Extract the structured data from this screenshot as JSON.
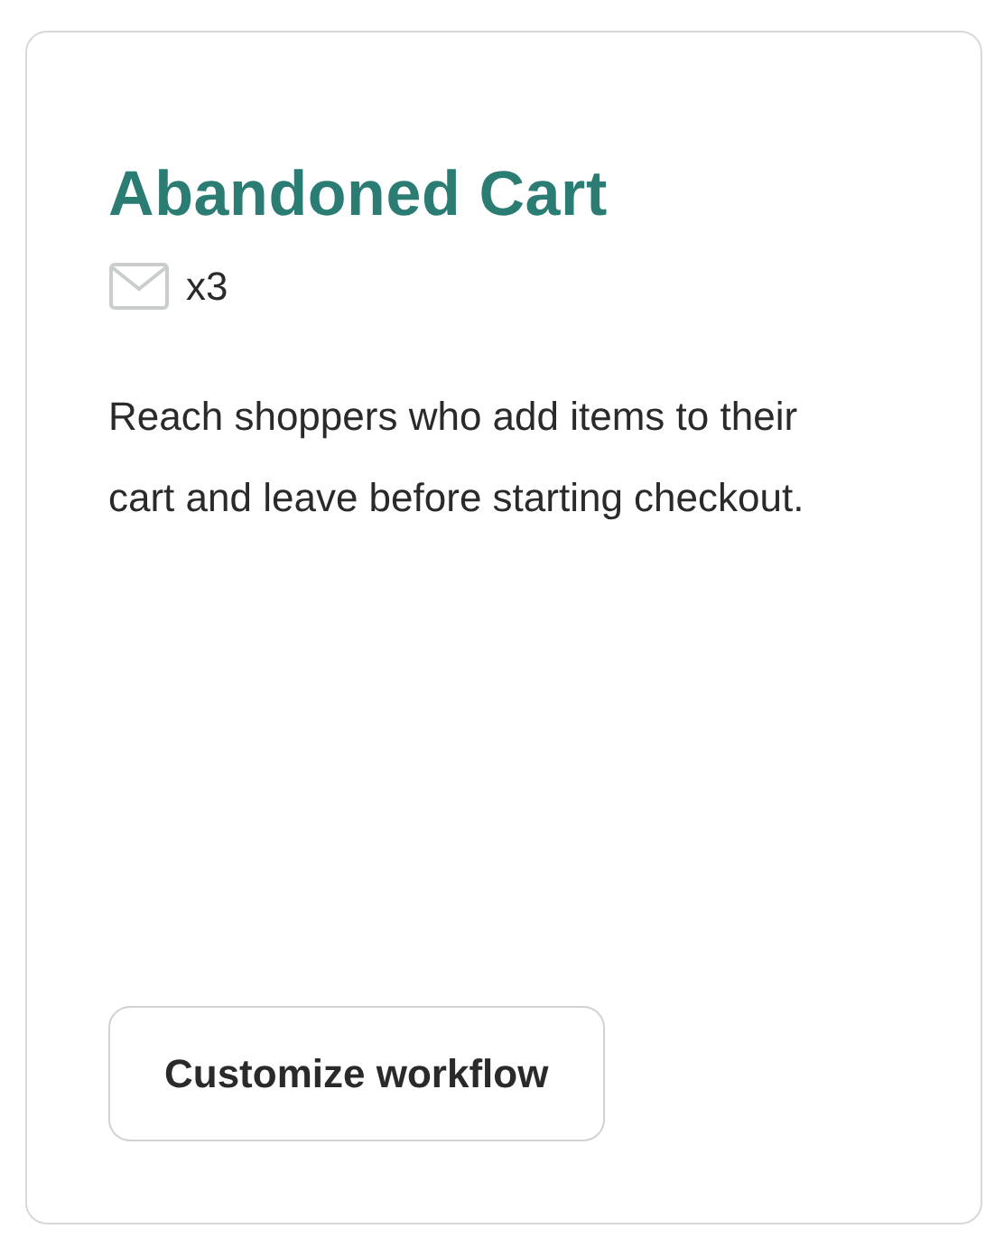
{
  "card": {
    "title": "Abandoned Cart",
    "email_count": "x3",
    "description": "Reach shoppers who add items to their cart and leave before starting checkout.",
    "button": "Customize workflow"
  }
}
